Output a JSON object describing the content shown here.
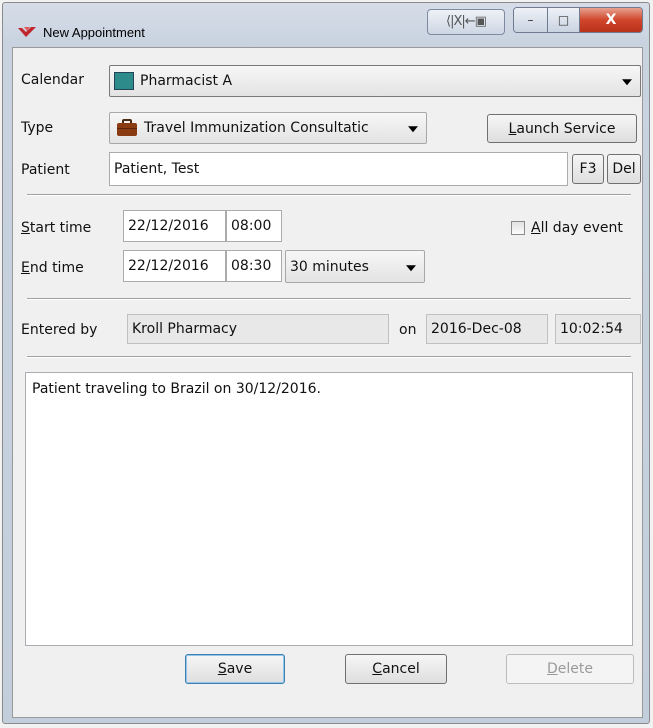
{
  "window": {
    "title": "New Appointment",
    "controls": {
      "extra": "⟨|X|←▣",
      "minimize": "–",
      "maximize": "□",
      "close": "X"
    }
  },
  "calendar": {
    "label": "Calendar",
    "value": "Pharmacist A",
    "swatch_color": "#2e8b8b"
  },
  "type": {
    "label": "Type",
    "value": "Travel Immunization Consultatic",
    "icon": "suitcase-icon"
  },
  "launch_service": {
    "pre": "",
    "accel": "L",
    "post": "aunch Service"
  },
  "patient": {
    "label": "Patient",
    "value": "Patient, Test",
    "f3_label": "F3",
    "del_label": "Del"
  },
  "start_time": {
    "label_accel": "S",
    "label_rest": "tart time",
    "date": "22/12/2016",
    "time": "08:00"
  },
  "end_time": {
    "label_accel": "E",
    "label_rest": "nd time",
    "date": "22/12/2016",
    "time": "08:30",
    "duration": "30 minutes"
  },
  "all_day": {
    "accel": "A",
    "rest": "ll day event",
    "checked": false
  },
  "entered_by": {
    "label": "Entered by",
    "value": "Kroll Pharmacy",
    "on_label": "on",
    "date": "2016-Dec-08",
    "time": "10:02:54"
  },
  "notes": "Patient traveling to Brazil on 30/12/2016.",
  "buttons": {
    "save": {
      "accel": "S",
      "rest": "ave"
    },
    "cancel": {
      "accel": "C",
      "rest": "ancel"
    },
    "delete": {
      "accel": "D",
      "rest": "elete"
    }
  }
}
